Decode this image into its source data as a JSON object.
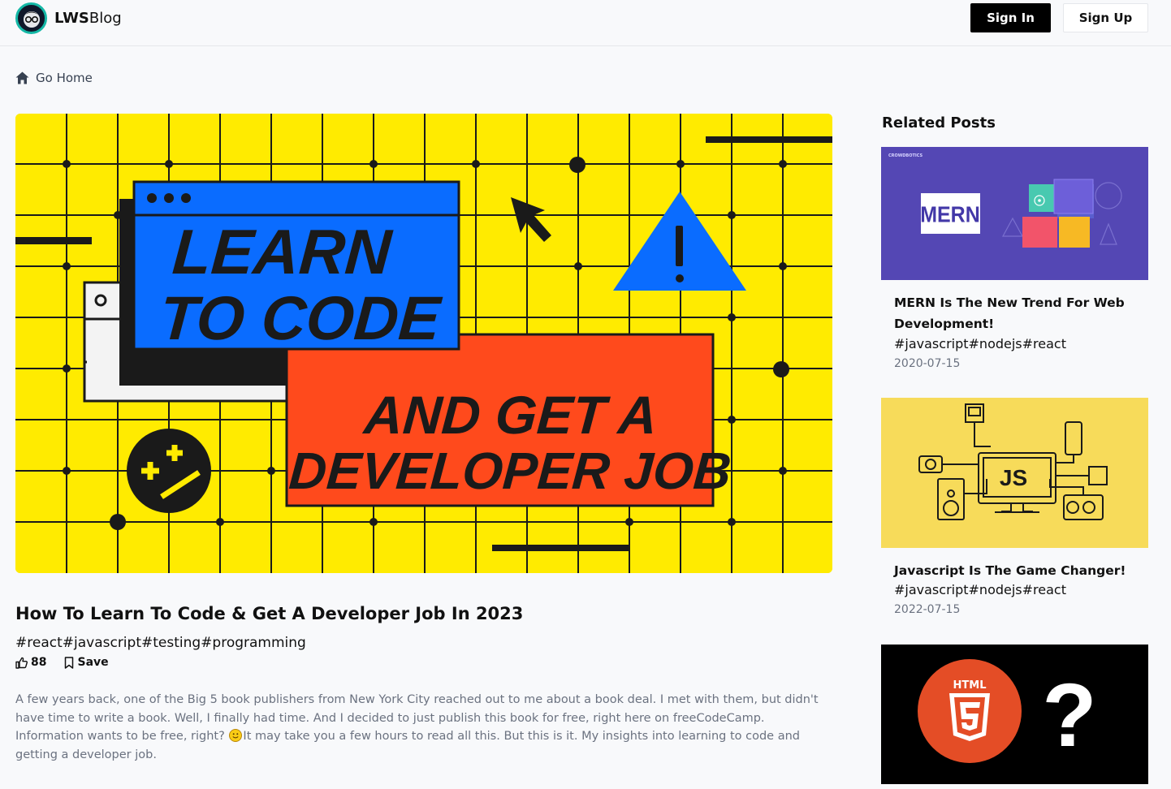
{
  "nav": {
    "brand_bold": "LWS",
    "brand_rest": "Blog",
    "signin": "Sign In",
    "signup": "Sign Up"
  },
  "gohome": "Go Home",
  "hero": {
    "line1": "LEARN",
    "line2": "TO CODE",
    "line3": "AND GET A",
    "line4": "DEVELOPER JOB"
  },
  "post": {
    "title": "How To Learn To Code & Get A Developer Job In 2023",
    "tags": "#react#javascript#testing#programming",
    "likes": "88",
    "save_label": "Save",
    "body_before_emoji": "A few years back, one of the Big 5 book publishers from New York City reached out to me about a book deal. I met with them, but didn't have time to write a book. Well, I finally had time. And I decided to just publish this book for free, right here on freeCodeCamp. Information wants to be free, right? ",
    "body_after_emoji": "It may take you a few hours to read all this. But this is it. My insights into learning to code and getting a developer job."
  },
  "related": {
    "heading": "Related Posts",
    "posts": [
      {
        "title": "MERN Is The New Trend For Web Development!",
        "tags": "#javascript#nodejs#react",
        "date": "2020-07-15",
        "image_text": "MERN",
        "image_caption": "CROWDBOTICS"
      },
      {
        "title": "Javascript Is The Game Changer!",
        "tags": "#javascript#nodejs#react",
        "date": "2022-07-15",
        "image_text": "JS"
      },
      {
        "image_text": "HTML",
        "image_symbol": "?"
      }
    ]
  },
  "colors": {
    "hero_yellow": "#ffeb00",
    "hero_blue": "#0a6cff",
    "hero_red": "#ff4a1c",
    "mern_purple": "#5447b4",
    "js_yellow": "#f7db5a",
    "html_orange": "#e44d26"
  }
}
